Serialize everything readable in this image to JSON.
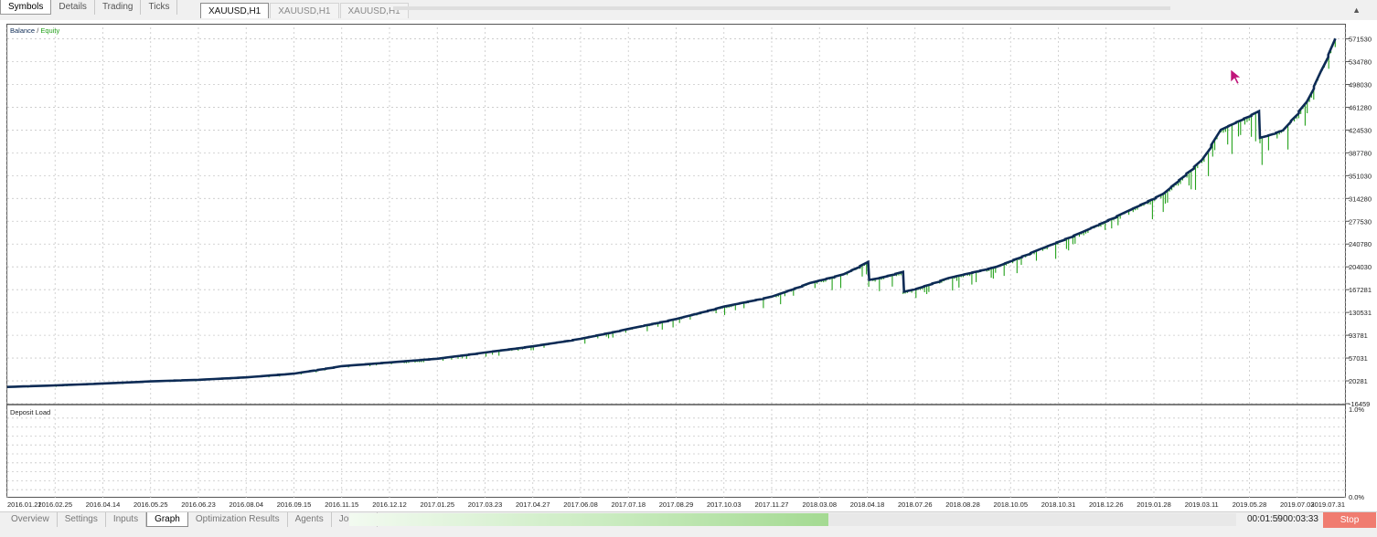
{
  "left_tabs": [
    {
      "label": "Symbols",
      "active": true
    },
    {
      "label": "Details",
      "active": false
    },
    {
      "label": "Trading",
      "active": false
    },
    {
      "label": "Ticks",
      "active": false
    }
  ],
  "chart_tabs": [
    {
      "label": "XAUUSD,H1",
      "active": true
    },
    {
      "label": "XAUUSD,H1",
      "active": false
    },
    {
      "label": "XAUUSD,H1",
      "active": false
    }
  ],
  "legend": {
    "balance": "Balance",
    "sep": " / ",
    "equity": "Equity"
  },
  "deposit_label": "Deposit Load",
  "bottom_tabs": [
    {
      "label": "Overview",
      "active": false
    },
    {
      "label": "Settings",
      "active": false
    },
    {
      "label": "Inputs",
      "active": false
    },
    {
      "label": "Graph",
      "active": true
    },
    {
      "label": "Optimization Results",
      "active": false
    },
    {
      "label": "Agents",
      "active": false
    },
    {
      "label": "Journal",
      "active": false
    }
  ],
  "progress_fraction": 0.54,
  "elapsed": "00:01:59",
  "time_sep": "/",
  "total": "00:03:33",
  "stop_label": "Stop",
  "colors": {
    "balance": "#0d2b55",
    "equity": "#23a11a",
    "grid": "#c8c8c8",
    "stop": "#f07c70"
  },
  "chart_data": {
    "type": "line",
    "title": "",
    "ylim": [
      -16459,
      590000
    ],
    "yticks": [
      571530,
      534780,
      498030,
      461280,
      424530,
      387780,
      351030,
      314280,
      277530,
      240780,
      204030,
      167281,
      130531,
      93781,
      57031,
      20281,
      -16459
    ],
    "xticks": [
      "2016.01.21",
      "2016.02.25",
      "2016.04.14",
      "2016.05.25",
      "2016.06.23",
      "2016.08.04",
      "2016.09.15",
      "2016.11.15",
      "2016.12.12",
      "2017.01.25",
      "2017.03.23",
      "2017.04.27",
      "2017.06.08",
      "2017.07.18",
      "2017.08.29",
      "2017.10.03",
      "2017.11.27",
      "2018.03.08",
      "2018.04.18",
      "2018.07.26",
      "2018.08.28",
      "2018.10.05",
      "2018.10.31",
      "2018.12.26",
      "2019.01.28",
      "2019.03.11",
      "2019.05.28",
      "2019.07.03",
      "2019.07.31"
    ],
    "series": [
      {
        "name": "Balance",
        "points": [
          [
            0,
            10500
          ],
          [
            1,
            13000
          ],
          [
            2,
            16000
          ],
          [
            3,
            19500
          ],
          [
            4,
            22000
          ],
          [
            5,
            26000
          ],
          [
            6,
            32000
          ],
          [
            7,
            44000
          ],
          [
            8,
            50000
          ],
          [
            9,
            56000
          ],
          [
            10,
            66000
          ],
          [
            11,
            76000
          ],
          [
            12,
            88000
          ],
          [
            13,
            104000
          ],
          [
            14,
            120000
          ],
          [
            15,
            140000
          ],
          [
            16,
            156000
          ],
          [
            16.8,
            178000
          ],
          [
            17.5,
            192000
          ],
          [
            18.02,
            212000
          ],
          [
            18.1,
            183000
          ],
          [
            18.75,
            196000
          ],
          [
            18.85,
            164000
          ],
          [
            19.7,
            186000
          ],
          [
            20.7,
            204000
          ],
          [
            21.6,
            232000
          ],
          [
            22.5,
            260000
          ],
          [
            23.4,
            292000
          ],
          [
            24.2,
            322000
          ],
          [
            25.0,
            376000
          ],
          [
            25.4,
            425000
          ],
          [
            26.2,
            455000
          ],
          [
            26.25,
            412000
          ],
          [
            26.7,
            424000
          ],
          [
            27.2,
            470000
          ],
          [
            27.5,
            520000
          ],
          [
            27.8,
            572000
          ]
        ]
      },
      {
        "name": "Equity",
        "points": []
      }
    ],
    "deposit_load": {
      "ylim": [
        0.0,
        1.0
      ],
      "ytick_labels": [
        "1.0%",
        "0.0%"
      ]
    }
  }
}
